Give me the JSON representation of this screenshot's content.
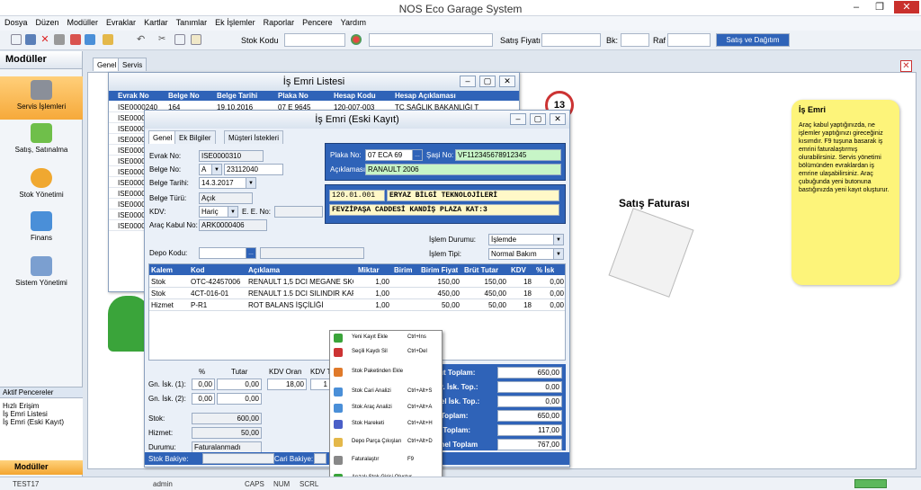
{
  "app": {
    "title": "NOS Eco Garage System"
  },
  "menu": [
    "Dosya",
    "Düzen",
    "Modüller",
    "Evraklar",
    "Kartlar",
    "Tanımlar",
    "Ek İşlemler",
    "Raporlar",
    "Pencere",
    "Yardım"
  ],
  "toolbar": {
    "stok_kodu": "Stok Kodu",
    "satis_fiyati": "Satış Fiyatı",
    "bk": "Bk:",
    "raf": "Raf",
    "satis_dagitim": "Satış ve Dağıtım"
  },
  "sidebar": {
    "title": "Modüller",
    "items": [
      "Servis İşlemleri",
      "Satış, Satınalma",
      "Stok Yönetimi",
      "Finans",
      "Sistem Yönetimi"
    ]
  },
  "aktif": {
    "title": "Aktif Pencereler",
    "items": [
      "Hızlı Erişim",
      "İş Emri Listesi",
      "İş Emri (Eski Kayıt)"
    ]
  },
  "moduller_btn": "Modüller",
  "status": {
    "user1": "TEST17",
    "user2": "admin",
    "caps": "CAPS",
    "num": "NUM",
    "scrl": "SCRL"
  },
  "tabs": [
    "Genel",
    "Servis"
  ],
  "list_win": {
    "title": "İş Emri Listesi",
    "cols": [
      "Evrak No",
      "Belge No",
      "Belge Tarihi",
      "Plaka No",
      "Hesap Kodu",
      "Hesap Açıklaması"
    ],
    "rows": [
      [
        "ISE0000240",
        "164",
        "19.10.2016",
        "07 E 9645",
        "120-007-003",
        "TC SAĞLIK BAKANLIĞI T"
      ],
      [
        "ISE0000",
        "",
        "",
        "",
        "",
        ""
      ],
      [
        "ISE0000",
        "",
        "",
        "",
        "",
        ""
      ],
      [
        "ISE0000",
        "",
        "",
        "",
        "",
        ""
      ],
      [
        "ISE0000",
        "",
        "",
        "",
        "",
        ""
      ],
      [
        "ISE0000",
        "",
        "",
        "",
        "",
        ""
      ],
      [
        "ISE0000",
        "",
        "",
        "",
        "",
        ""
      ],
      [
        "ISE0000",
        "",
        "",
        "",
        "",
        ""
      ],
      [
        "ISE0000",
        "",
        "",
        "",
        "",
        ""
      ],
      [
        "ISE0000",
        "",
        "",
        "",
        "",
        ""
      ],
      [
        "ISE0000",
        "",
        "",
        "",
        "",
        ""
      ],
      [
        "ISE0000",
        "",
        "",
        "",
        "",
        ""
      ]
    ]
  },
  "badge": "13",
  "satis_faturasi": "Satış Faturası",
  "note": {
    "title": "İş Emri",
    "text": "Araç kabul yaptığınızda, ne işlemler yaptığınızı gireceğiniz kısımdır. F9 tuşuna basarak iş emrini faturalaştırmış olurabilirsiniz. Servis yönetimi bölümünden evraklardan iş emrine ulaşabilirsiniz. Araç çubuğunda yeni butonuna bastığınızda yeni kayıt oluşturur."
  },
  "form": {
    "title": "İş Emri (Eski Kayıt)",
    "tabs": [
      "Genel",
      "Ek Bilgiler",
      "Müşteri İstekleri"
    ],
    "evrak_no_l": "Evrak No:",
    "evrak_no": "ISE0000310",
    "belge_no_l": "Belge No:",
    "belge_seri": "A",
    "belge_no": "23112040",
    "belge_tarihi_l": "Belge Tarihi:",
    "belge_tarihi": "14.3.2017",
    "belge_turu_l": "Belge Türü:",
    "belge_turu": "Açık",
    "kdv_l": "KDV:",
    "kdv": "Hariç",
    "ee_l": "E. E. No:",
    "arac_kabul_l": "Araç Kabul No:",
    "arac_kabul": "ARK0000406",
    "depo_l": "Depo Kodu:",
    "plaka_l": "Plaka No:",
    "plaka": "07 ECA 69",
    "sasi_l": "Şaşi No:",
    "sasi": "VF112345678912345",
    "aciklama_l": "Açıklaması:",
    "aciklama": "RANAULT 2006",
    "hesap_kod": "120.01.001",
    "hesap_ad": "ERYAZ BİLGİ TEKNOLOJİLERİ",
    "adres": "FEVZİPAŞA CADDESİ KANDİŞ PLAZA KAT:3",
    "islem_durumu_l": "İşlem Durumu:",
    "islem_durumu": "İşlemde",
    "islem_tipi_l": "İşlem Tipi:",
    "islem_tipi": "Normal Bakım",
    "cols": [
      "Kalem",
      "Kod",
      "Açıklama",
      "Miktar",
      "Birim",
      "Birim Fiyat",
      "Brüt Tutar",
      "KDV",
      "% İsk"
    ],
    "rows": [
      [
        "Stok",
        "OTC-42457006",
        "RENAULT 1,5 DCI MEGANE SKC C",
        "1,00",
        "",
        "150,00",
        "150,00",
        "18",
        "0,00"
      ],
      [
        "Stok",
        "4CT-016-01",
        "RENAULT 1.5 DCI SILINDIR KAP.",
        "1,00",
        "",
        "450,00",
        "450,00",
        "18",
        "0,00"
      ],
      [
        "Hizmet",
        "P-R1",
        "ROT BALANS İŞÇİLİĞİ",
        "1,00",
        "",
        "50,00",
        "50,00",
        "18",
        "0,00"
      ]
    ],
    "pct": "%",
    "tutar": "Tutar",
    "kdv_oran": "KDV Oran",
    "kdv_t": "KDV T",
    "isk1_l": "Gn. İsk. (1):",
    "isk1_p": "0,00",
    "isk1_t": "0,00",
    "kdv_oran_v": "18,00",
    "kdv_t_v": "1",
    "isk2_l": "Gn. İsk. (2):",
    "isk2_p": "0,00",
    "isk2_t": "0,00",
    "stok_l": "Stok:",
    "stok": "600,00",
    "hizmet_l": "Hizmet:",
    "hizmet": "50,00",
    "durum_l": "Durumu:",
    "durum": "Faturalanmadı",
    "stok_bakiye": "Stok Bakiye:",
    "cari_bakiye": "Cari Bakiye:",
    "totals": [
      [
        "rüt Toplam:",
        "650,00"
      ],
      [
        "tır. İsk. Top.:",
        "0,00"
      ],
      [
        "nel İsk. Top.:",
        "0,00"
      ],
      [
        "t Toplam:",
        "650,00"
      ],
      [
        "V Toplam:",
        "117,00"
      ],
      [
        "enel Toplam",
        "767,00"
      ]
    ]
  },
  "ctx": [
    [
      "Yeni Kayıt Ekle",
      "Ctrl+Ins"
    ],
    [
      "Seçili Kaydı Sil",
      "Ctrl+Del"
    ],
    [
      "Stok Paketinden Ekle",
      ""
    ],
    [
      "Stok Cari Analizi",
      "Ctrl+Alt+S"
    ],
    [
      "Stok Araç Analizi",
      "Ctrl+Alt+A"
    ],
    [
      "Stok Hareketi",
      "Ctrl+Alt+H"
    ],
    [
      "Depo Parça Çıkışları",
      "Ctrl+Alt+D"
    ],
    [
      "Faturalaştır",
      "F9"
    ],
    [
      "Arızalı Stok Girişi Oluştur",
      ""
    ]
  ]
}
